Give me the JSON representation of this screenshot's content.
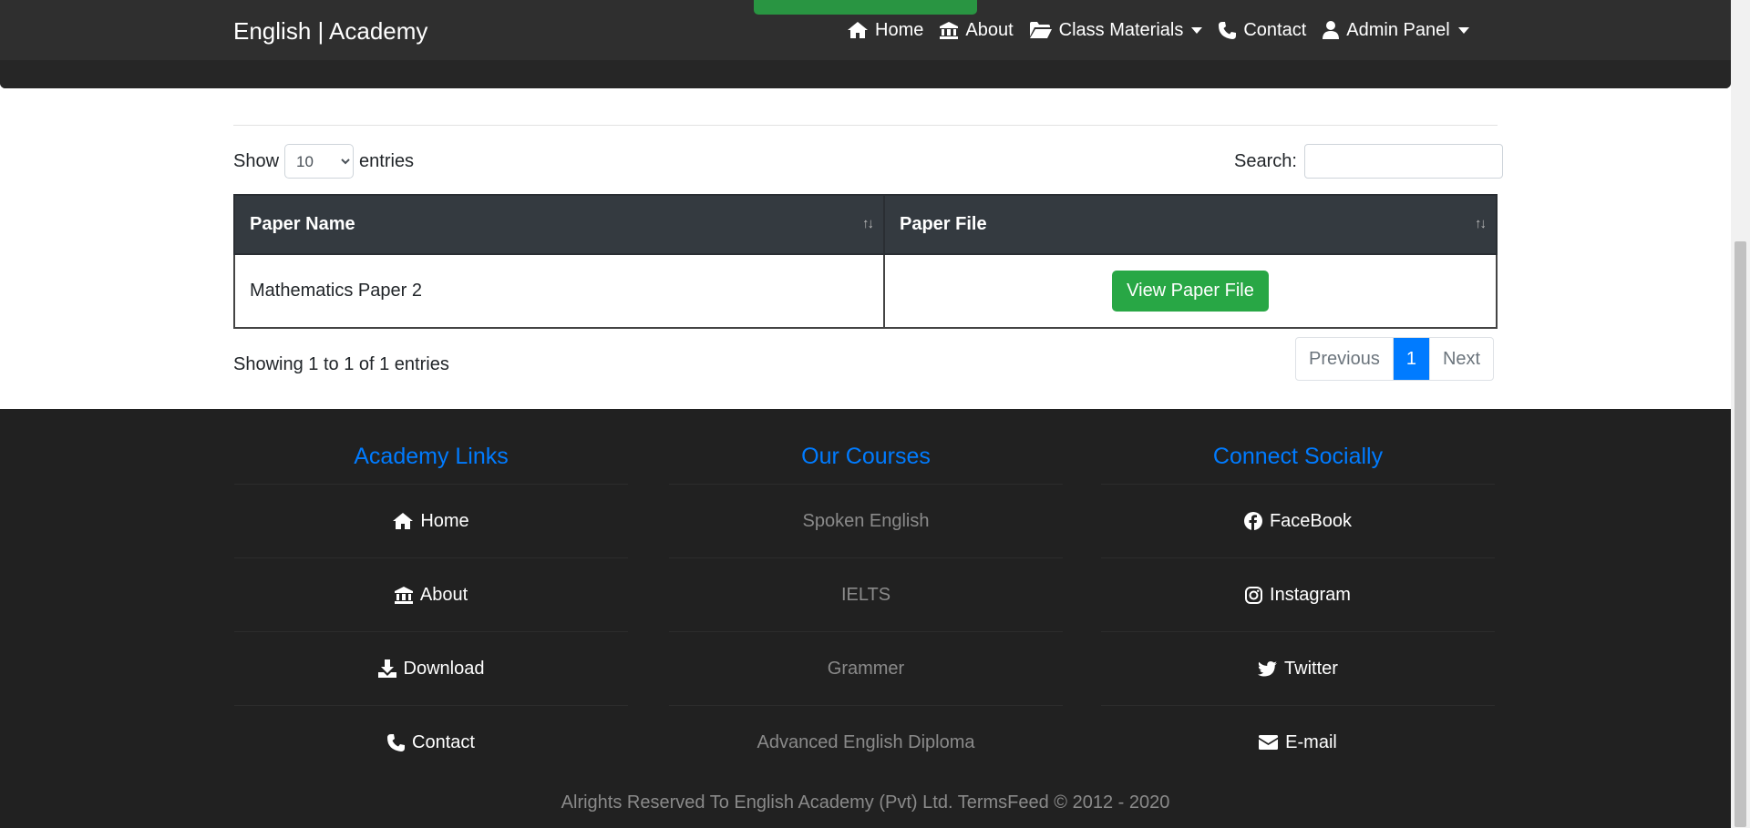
{
  "brand": "English | Academy",
  "nav": [
    {
      "label": "Home",
      "icon": "home-icon"
    },
    {
      "label": "About",
      "icon": "bank-icon"
    },
    {
      "label": "Class Materials",
      "icon": "folder-icon",
      "dropdown": true
    },
    {
      "label": "Contact",
      "icon": "phone-icon"
    },
    {
      "label": "Admin Panel",
      "icon": "user-icon",
      "dropdown": true
    }
  ],
  "table_controls": {
    "show_label": "Show",
    "entries_value": "10",
    "entries_label": "entries",
    "search_label": "Search:"
  },
  "table": {
    "headers": [
      "Paper Name",
      "Paper File"
    ],
    "rows": [
      {
        "name": "Mathematics Paper 2",
        "button": "View Paper File"
      }
    ]
  },
  "info": "Showing 1 to 1 of 1 entries",
  "pager": {
    "previous": "Previous",
    "page": "1",
    "next": "Next"
  },
  "footer": {
    "academy_links": {
      "title": "Academy Links",
      "items": [
        "Home",
        "About",
        "Download",
        "Contact"
      ]
    },
    "courses": {
      "title": "Our Courses",
      "items": [
        "Spoken English",
        "IELTS",
        "Grammer",
        "Advanced English Diploma"
      ]
    },
    "social": {
      "title": "Connect Socially",
      "items": [
        "FaceBook",
        "Instagram",
        "Twitter",
        "E-mail"
      ]
    },
    "copyright": "Alrights Reserved To English Academy (Pvt) Ltd.   TermsFeed © 2012 - 2020"
  },
  "colors": {
    "accent": "#007bff",
    "success": "#28a745",
    "navbar": "#2f2f2f",
    "footer": "#212121"
  }
}
